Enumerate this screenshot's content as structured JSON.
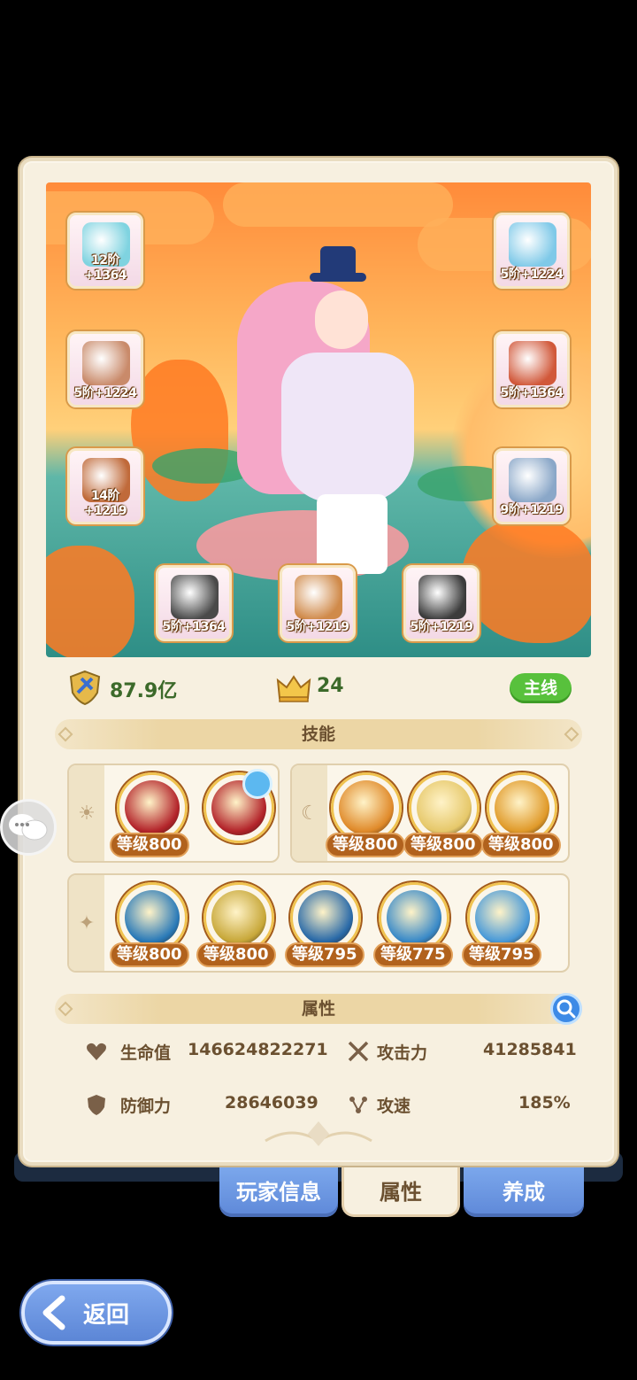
{
  "equipment": [
    {
      "id": "bow",
      "label": "12阶+1364",
      "color": "#7fd3e0"
    },
    {
      "id": "helmet",
      "label": "5阶+1224",
      "color": "#7fc9e8"
    },
    {
      "id": "armor",
      "label": "5阶+1224",
      "color": "#c98a6a"
    },
    {
      "id": "shoulder",
      "label": "5阶+1364",
      "color": "#d1583a"
    },
    {
      "id": "belt",
      "label": "14阶+1219",
      "color": "#c06a3a"
    },
    {
      "id": "boots",
      "label": "9阶+1219",
      "color": "#8aa7c8"
    },
    {
      "id": "ring",
      "label": "5阶+1364",
      "color": "#4a4a4a"
    },
    {
      "id": "necklace",
      "label": "5阶+1219",
      "color": "#d08a4a"
    },
    {
      "id": "amulet",
      "label": "5阶+1219",
      "color": "#3c3c3c"
    }
  ],
  "stats": {
    "power": "87.9亿",
    "crown": "24",
    "mainline": "主线"
  },
  "skills_section_title": "技能",
  "skill_groups": [
    {
      "side_icon": "☀",
      "skills": [
        {
          "level": "等级800",
          "color": "#b3242a"
        },
        {
          "level": "",
          "color": "#b3242a"
        }
      ]
    },
    {
      "side_icon": "☾",
      "skills": [
        {
          "level": "等级800",
          "color": "#e08a2a"
        },
        {
          "level": "等级800",
          "color": "#e6c86a"
        },
        {
          "level": "等级800",
          "color": "#e09a2a"
        }
      ]
    },
    {
      "side_icon": "✦",
      "skills": [
        {
          "level": "等级800",
          "color": "#2a7ab8"
        },
        {
          "level": "等级800",
          "color": "#c8a83a"
        },
        {
          "level": "等级795",
          "color": "#2a6aa8"
        },
        {
          "level": "等级775",
          "color": "#3a8ac8"
        },
        {
          "level": "等级795",
          "color": "#4a9ad8"
        }
      ]
    }
  ],
  "attributes_section_title": "属性",
  "attributes": {
    "hp_label": "生命值",
    "hp_value": "146624822271",
    "atk_label": "攻击力",
    "atk_value": "41285841",
    "def_label": "防御力",
    "def_value": "28646039",
    "spd_label": "攻速",
    "spd_value": "185%"
  },
  "tabs": [
    "玩家信息",
    "属性",
    "养成"
  ],
  "back_label": "返回"
}
